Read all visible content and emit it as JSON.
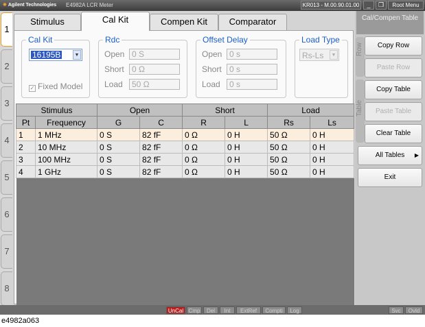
{
  "titlebar": {
    "brand": "Agilent Technologies",
    "title": "E4982A LCR Meter",
    "firmware": "KR013 - M.00.90.01.00",
    "minimize": "_",
    "restore": "❒",
    "root_menu": "Root Menu"
  },
  "channels": [
    "1",
    "2",
    "3",
    "4",
    "5",
    "6",
    "7",
    "8"
  ],
  "tabs": [
    "Stimulus",
    "Cal Kit",
    "Compen Kit",
    "Comparator"
  ],
  "cal_kit": {
    "legend": "Cal Kit",
    "selected": "16195B",
    "fixed_model_label": "Fixed Model",
    "fixed_model_mark": "✓"
  },
  "rdc": {
    "legend": "Rdc",
    "open_label": "Open",
    "open_value": "0 S",
    "short_label": "Short",
    "short_value": "0 Ω",
    "load_label": "Load",
    "load_value": "50 Ω"
  },
  "offset_delay": {
    "legend": "Offset Delay",
    "open_label": "Open",
    "open_value": "0 s",
    "short_label": "Short",
    "short_value": "0 s",
    "load_label": "Load",
    "load_value": "0 s"
  },
  "load_type": {
    "legend": "Load Type",
    "selected": "Rs-Ls"
  },
  "table": {
    "group_headers": [
      "Stimulus",
      "Open",
      "Short",
      "Load"
    ],
    "columns": [
      "Pt",
      "Frequency",
      "G",
      "C",
      "R",
      "L",
      "Rs",
      "Ls"
    ],
    "rows": [
      [
        "1",
        "1 MHz",
        "0 S",
        "82 fF",
        "0 Ω",
        "0 H",
        "50 Ω",
        "0 H"
      ],
      [
        "2",
        "10 MHz",
        "0 S",
        "82 fF",
        "0 Ω",
        "0 H",
        "50 Ω",
        "0 H"
      ],
      [
        "3",
        "100 MHz",
        "0 S",
        "82 fF",
        "0 Ω",
        "0 H",
        "50 Ω",
        "0 H"
      ],
      [
        "4",
        "1 GHz",
        "0 S",
        "82 fF",
        "0 Ω",
        "0 H",
        "50 Ω",
        "0 H"
      ]
    ]
  },
  "softkeys": {
    "menu_title": "Cal/Compen Table",
    "row_label": "Row",
    "table_label": "Table",
    "copy_row": "Copy Row",
    "paste_row": "Paste Row",
    "copy_table": "Copy Table",
    "paste_table": "Paste Table",
    "clear_table": "Clear Table",
    "all_tables": "All Tables",
    "all_tables_more": "▶",
    "exit": "Exit"
  },
  "statusbar": [
    "UnCal",
    "Cmp",
    "Del",
    "Int",
    "ExtRef",
    "Compti",
    "Log",
    "Svc",
    "Ovld"
  ],
  "caption": "e4982a063"
}
